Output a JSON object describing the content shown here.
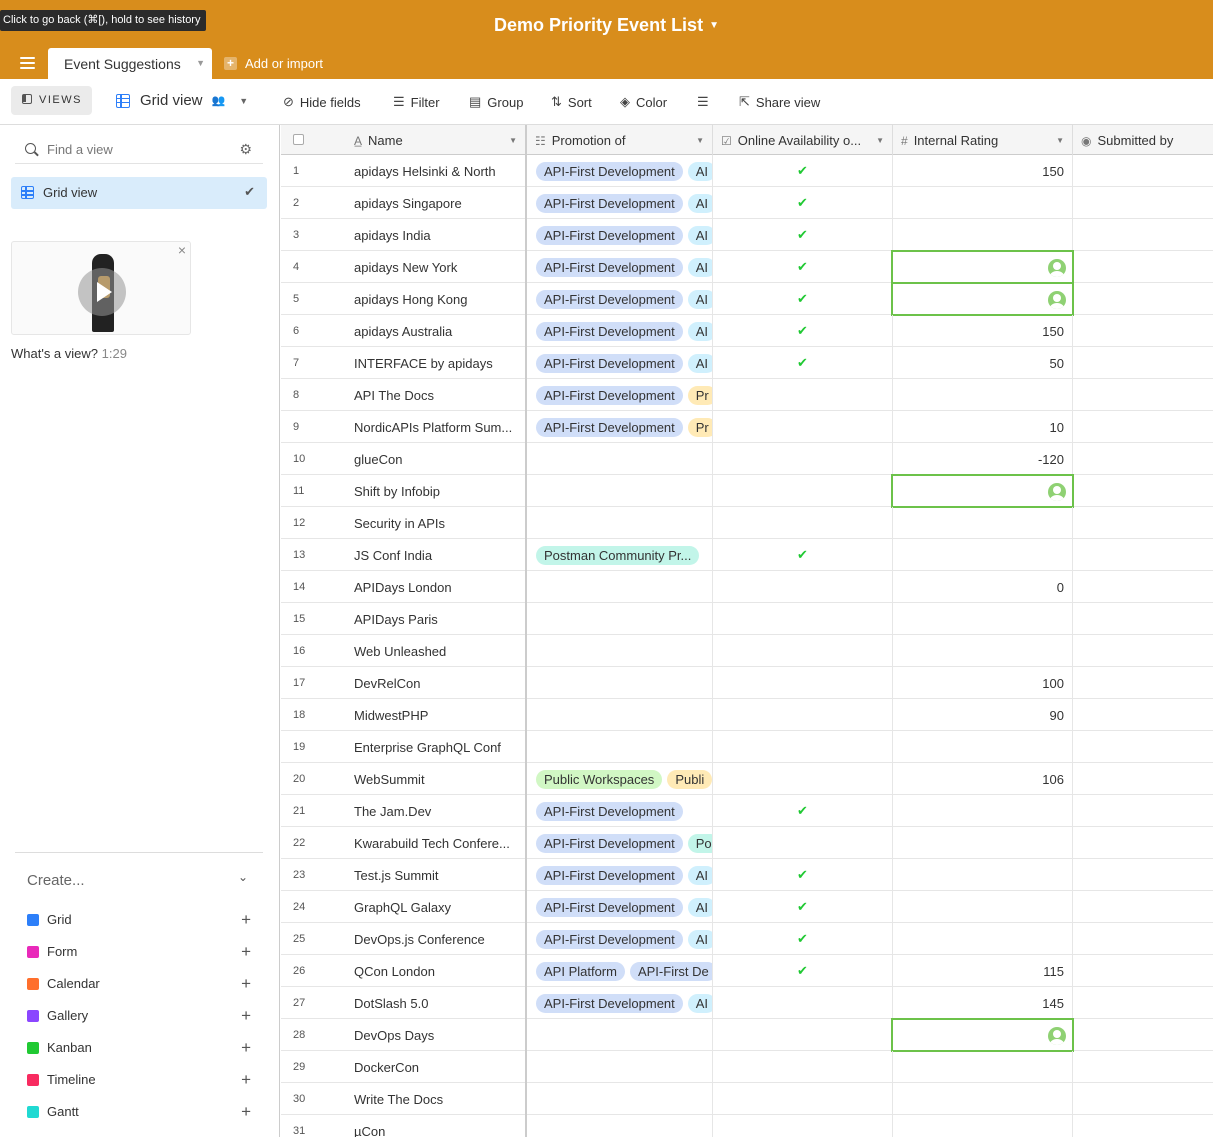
{
  "tooltip": "Click to go back (⌘[), hold to see history",
  "base": {
    "title": "Demo Priority Event List"
  },
  "tabs": {
    "active": "Event Suggestions",
    "add_import": "Add or import"
  },
  "toolbar": {
    "views": "VIEWS",
    "view_name": "Grid view",
    "hide_fields": "Hide fields",
    "filter": "Filter",
    "group": "Group",
    "sort": "Sort",
    "color": "Color",
    "share": "Share view"
  },
  "sidebar": {
    "find_placeholder": "Find a view",
    "views": [
      {
        "label": "Grid view"
      }
    ],
    "video": {
      "caption": "What's a view?",
      "duration": "1:29"
    },
    "create": {
      "header": "Create...",
      "items": [
        {
          "label": "Grid",
          "color": "#2d7ff9"
        },
        {
          "label": "Form",
          "color": "#e929ba"
        },
        {
          "label": "Calendar",
          "color": "#ff6f2c"
        },
        {
          "label": "Gallery",
          "color": "#8b46ff"
        },
        {
          "label": "Kanban",
          "color": "#20c933"
        },
        {
          "label": "Timeline",
          "color": "#f82b60"
        },
        {
          "label": "Gantt",
          "color": "#20d9d2"
        }
      ]
    }
  },
  "grid": {
    "columns": {
      "name": "Name",
      "promotion": "Promotion of",
      "online": "Online Availability o...",
      "rating": "Internal Rating",
      "submitted": "Submitted by"
    },
    "pill_colors": {
      "API-First Development": "#d0def8",
      "API Platform": "#d0def8",
      "Postman Community Pr...": "#c2f5e9",
      "Public Workspaces": "#d1f7c4",
      "Publi": "#ffeab6",
      "AI": "#d0f0fd",
      "Pr": "#ffeab6",
      "Po": "#c2f5e9",
      "API-First De": "#d0def8"
    },
    "rows": [
      {
        "num": "1",
        "name": "apidays Helsinki & North",
        "promo": [
          "API-First Development",
          "AI"
        ],
        "online": true,
        "rating": "150"
      },
      {
        "num": "2",
        "name": "apidays Singapore",
        "promo": [
          "API-First Development",
          "AI"
        ],
        "online": true,
        "rating": ""
      },
      {
        "num": "3",
        "name": "apidays India",
        "promo": [
          "API-First Development",
          "AI"
        ],
        "online": true,
        "rating": ""
      },
      {
        "num": "4",
        "name": "apidays New York",
        "promo": [
          "API-First Development",
          "AI"
        ],
        "online": true,
        "rating": "",
        "user": true
      },
      {
        "num": "5",
        "name": "apidays Hong Kong",
        "promo": [
          "API-First Development",
          "AI"
        ],
        "online": true,
        "rating": "",
        "user": true
      },
      {
        "num": "6",
        "name": "apidays Australia",
        "promo": [
          "API-First Development",
          "AI"
        ],
        "online": true,
        "rating": "150"
      },
      {
        "num": "7",
        "name": "INTERFACE by apidays",
        "promo": [
          "API-First Development",
          "AI"
        ],
        "online": true,
        "rating": "50"
      },
      {
        "num": "8",
        "name": "API The Docs",
        "promo": [
          "API-First Development",
          "Pr"
        ],
        "online": false,
        "rating": ""
      },
      {
        "num": "9",
        "name": "NordicAPIs Platform Sum...",
        "promo": [
          "API-First Development",
          "Pr"
        ],
        "online": false,
        "rating": "10"
      },
      {
        "num": "10",
        "name": "glueCon",
        "promo": [],
        "online": false,
        "rating": "-120"
      },
      {
        "num": "11",
        "name": "Shift by Infobip",
        "promo": [],
        "online": false,
        "rating": "-",
        "user": true
      },
      {
        "num": "12",
        "name": "Security in APIs",
        "promo": [],
        "online": false,
        "rating": ""
      },
      {
        "num": "13",
        "name": "JS Conf India",
        "promo": [
          "Postman Community Pr..."
        ],
        "online": true,
        "rating": ""
      },
      {
        "num": "14",
        "name": "APIDays London",
        "promo": [],
        "online": false,
        "rating": "0"
      },
      {
        "num": "15",
        "name": "APIDays Paris",
        "promo": [],
        "online": false,
        "rating": ""
      },
      {
        "num": "16",
        "name": "Web Unleashed",
        "promo": [],
        "online": false,
        "rating": ""
      },
      {
        "num": "17",
        "name": "DevRelCon",
        "promo": [],
        "online": false,
        "rating": "100"
      },
      {
        "num": "18",
        "name": "MidwestPHP",
        "promo": [],
        "online": false,
        "rating": "90"
      },
      {
        "num": "19",
        "name": "Enterprise GraphQL Conf",
        "promo": [],
        "online": false,
        "rating": ""
      },
      {
        "num": "20",
        "name": "WebSummit",
        "promo": [
          "Public Workspaces",
          "Publi"
        ],
        "online": false,
        "rating": "106"
      },
      {
        "num": "21",
        "name": "The Jam.Dev",
        "promo": [
          "API-First Development"
        ],
        "online": true,
        "rating": ""
      },
      {
        "num": "22",
        "name": "Kwarabuild Tech Confere...",
        "promo": [
          "API-First Development",
          "Po"
        ],
        "online": false,
        "rating": ""
      },
      {
        "num": "23",
        "name": "Test.js Summit",
        "promo": [
          "API-First Development",
          "AI"
        ],
        "online": true,
        "rating": ""
      },
      {
        "num": "24",
        "name": "GraphQL Galaxy",
        "promo": [
          "API-First Development",
          "AI"
        ],
        "online": true,
        "rating": ""
      },
      {
        "num": "25",
        "name": "DevOps.js Conference",
        "promo": [
          "API-First Development",
          "AI"
        ],
        "online": true,
        "rating": ""
      },
      {
        "num": "26",
        "name": "QCon London",
        "promo": [
          "API Platform",
          "API-First De"
        ],
        "online": true,
        "rating": "115"
      },
      {
        "num": "27",
        "name": "DotSlash 5.0",
        "promo": [
          "API-First Development",
          "AI"
        ],
        "online": false,
        "rating": "145"
      },
      {
        "num": "28",
        "name": "DevOps Days",
        "promo": [],
        "online": false,
        "rating": "",
        "user": true
      },
      {
        "num": "29",
        "name": "DockerCon",
        "promo": [],
        "online": false,
        "rating": ""
      },
      {
        "num": "30",
        "name": "Write The Docs",
        "promo": [],
        "online": false,
        "rating": ""
      },
      {
        "num": "31",
        "name": "µCon",
        "promo": [],
        "online": false,
        "rating": ""
      }
    ]
  }
}
